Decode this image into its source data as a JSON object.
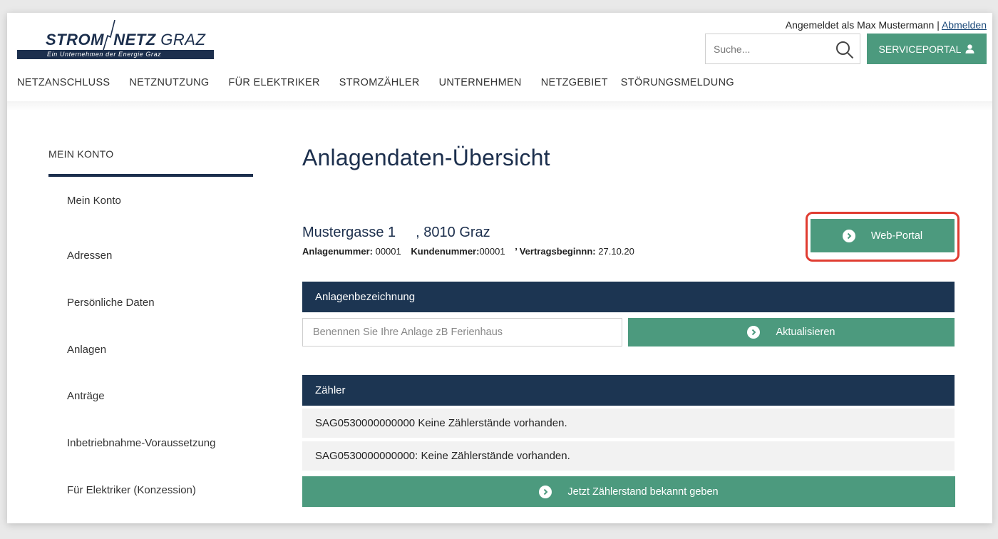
{
  "header": {
    "logo_main_left": "STROM",
    "logo_main_mid": "NETZ",
    "logo_main_right": "GRAZ",
    "logo_tagline": "Ein Unternehmen der Energie Graz",
    "login_text": "Angemeldet als Max Mustermann | ",
    "logout_link": "Abmelden",
    "search_placeholder": "Suche...",
    "service_portal_label": "SERVICEPORTAL"
  },
  "nav": {
    "items": [
      "NETZANSCHLUSS",
      "NETZNUTZUNG",
      "FÜR ELEKTRIKER",
      "STROMZÄHLER",
      "UNTERNEHMEN",
      "NETZGEBIET",
      "STÖRUNGSMELDUNG"
    ]
  },
  "sidebar": {
    "title": "MEIN KONTO",
    "items": [
      "Mein Konto",
      "Adressen",
      "Persönliche Daten",
      "Anlagen",
      "Anträge",
      "Inbetriebnahme-Voraussetzung",
      "Für Elektriker (Konzession)"
    ]
  },
  "main": {
    "title": "Anlagendaten-Übersicht",
    "address_street": "Mustergasse 1",
    "address_city": ", 8010 Graz",
    "anlagennummer_label": "Anlagenummer:",
    "anlagennummer_value": "00001",
    "kundennummer_label": "Kundenummer:",
    "kundennummer_value": "00001",
    "vertrag_label": "’ Vertragsbeginnn:",
    "vertrag_value": "27.10.20",
    "web_portal_label": "Web-Portal",
    "anlagenbezeichnung_header": "Anlagenbezeichnung",
    "name_placeholder": "Benennen Sie Ihre Anlage zB Ferienhaus",
    "update_label": "Aktualisieren",
    "zaehler_header": "Zähler",
    "meters": [
      {
        "id": "SAG0530000000000",
        "status": "Keine Zählerstände vorhanden."
      },
      {
        "id": "SAG0530000000000:",
        "status": "Keine Zählerstände vorhanden."
      }
    ],
    "report_label": "Jetzt Zählerstand bekannt geben"
  },
  "colors": {
    "brand_navy": "#1c2f4d",
    "section_header": "#1c3552",
    "button_green": "#4c9a7e",
    "highlight_red": "#e03c31"
  }
}
